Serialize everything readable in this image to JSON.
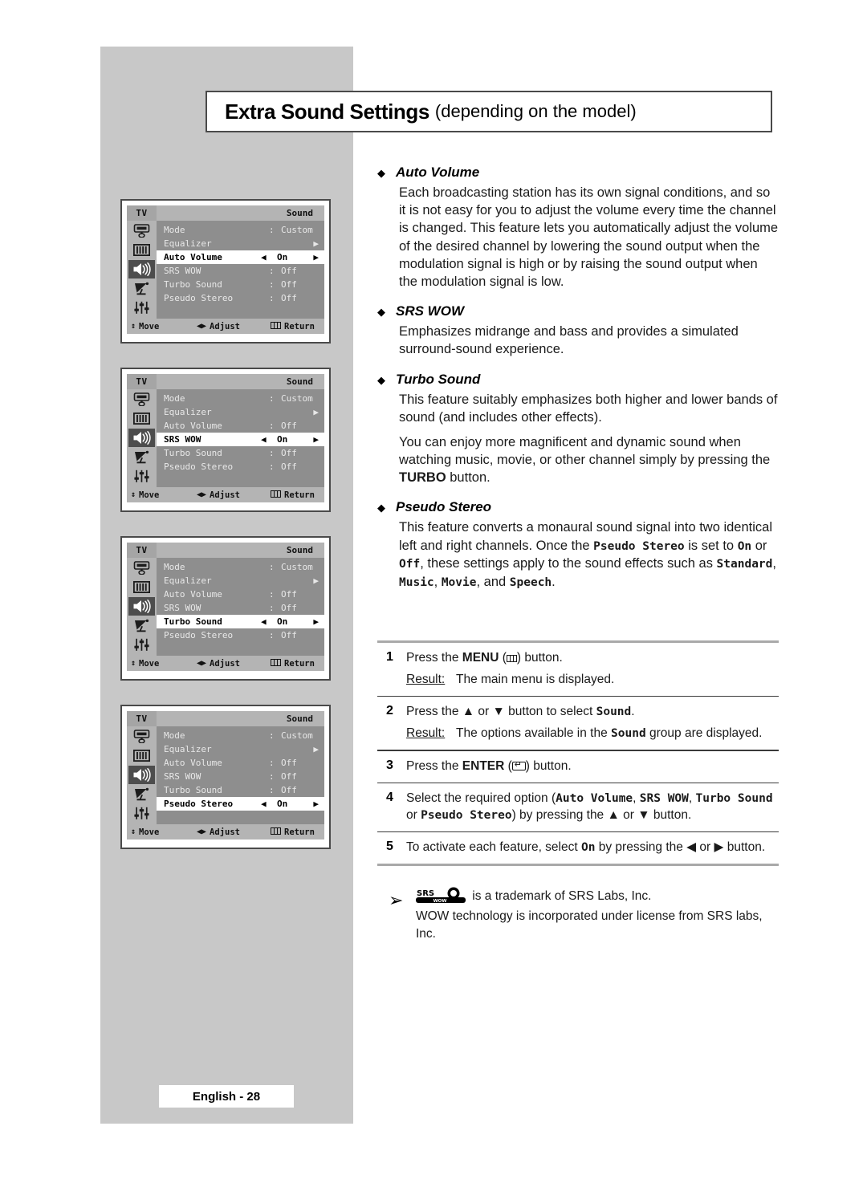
{
  "header": {
    "title_main": "Extra Sound Settings",
    "title_sub": "(depending on the model)"
  },
  "osd_common": {
    "tv_tag": "TV",
    "group_title": "Sound",
    "bottom_bar": {
      "move_label": "Move",
      "adjust_label": "Adjust",
      "return_label": "Return",
      "move_glyph": "↕",
      "adjust_glyph": "◀▶"
    },
    "icons": [
      "picture-icon",
      "equalizer-icon",
      "speaker-icon",
      "satellite-dish-icon",
      "sliders-icon"
    ],
    "rows": {
      "mode": "Mode",
      "equalizer": "Equalizer",
      "auto_volume": "Auto Volume",
      "srs_wow": "SRS WOW",
      "turbo_sound": "Turbo Sound",
      "pseudo_stereo": "Pseudo Stereo"
    },
    "values": {
      "custom": "Custom",
      "on": "On",
      "off": "Off",
      "colon": ":",
      "left_arrow": "◀",
      "right_arrow": "▶",
      "submenu_arrow": "▶"
    }
  },
  "osd_panels": [
    {
      "name": "panel-auto-volume",
      "selected": "auto_volume",
      "values": {
        "auto_volume": "On",
        "srs_wow": "Off",
        "turbo_sound": "Off",
        "pseudo_stereo": "Off"
      }
    },
    {
      "name": "panel-srs-wow",
      "selected": "srs_wow",
      "values": {
        "auto_volume": "Off",
        "srs_wow": "On",
        "turbo_sound": "Off",
        "pseudo_stereo": "Off"
      }
    },
    {
      "name": "panel-turbo-sound",
      "selected": "turbo_sound",
      "values": {
        "auto_volume": "Off",
        "srs_wow": "Off",
        "turbo_sound": "On",
        "pseudo_stereo": "Off"
      }
    },
    {
      "name": "panel-pseudo-stereo",
      "selected": "pseudo_stereo",
      "values": {
        "auto_volume": "Off",
        "srs_wow": "Off",
        "turbo_sound": "Off",
        "pseudo_stereo": "On"
      }
    }
  ],
  "features": [
    {
      "bullet": "◆",
      "title": "Auto Volume",
      "paragraphs": [
        "Each broadcasting station has its own signal conditions, and so it is not easy for you to adjust the volume every time the channel is changed. This feature lets you automatically adjust the volume of the desired channel by lowering the sound output when the modulation signal is high or by raising the sound output when the modulation signal is low."
      ]
    },
    {
      "bullet": "◆",
      "title": "SRS WOW",
      "paragraphs": [
        "Emphasizes midrange and bass and provides a simulated surround-sound experience."
      ]
    },
    {
      "bullet": "◆",
      "title": "Turbo Sound",
      "paragraphs": [
        "This feature suitably emphasizes both higher and lower bands of sound (and includes other effects)."
      ]
    },
    {
      "bullet": "◆",
      "title": "Pseudo Stereo",
      "paragraphs": []
    }
  ],
  "turbo_second_para": {
    "pre": "You can enjoy more magnificent and dynamic sound when watching music, movie, or other channel simply by pressing the ",
    "bold": "TURBO",
    "post": " button."
  },
  "pseudo_para": {
    "p1": "This feature converts a monaural sound signal into two identical left and right channels. Once the ",
    "m1": "Pseudo Stereo",
    "p2": " is set to ",
    "m2": "On",
    "p3": " or ",
    "m3": "Off",
    "p4": ", these settings apply to the sound effects such as ",
    "m4": "Standard",
    "p5": ", ",
    "m5": "Music",
    "p6": ", ",
    "m6": "Movie",
    "p7": ", and ",
    "m7": "Speech",
    "p8": "."
  },
  "steps": {
    "step1": {
      "num": "1",
      "pre": "Press the ",
      "bold": "MENU",
      "mid": " (",
      "post": ") button.",
      "result_label": "Result:",
      "result_text": "The main menu is displayed."
    },
    "step2": {
      "num": "2",
      "pre": "Press the ▲ or ▼ button to select ",
      "mono": "Sound",
      "post": ".",
      "result_label": "Result:",
      "result_pre": "The options available in the ",
      "result_mono": "Sound",
      "result_post": " group are displayed."
    },
    "step3": {
      "num": "3",
      "pre": "Press the ",
      "bold": "ENTER",
      "mid": " (",
      "post": ") button."
    },
    "step4": {
      "num": "4",
      "pre": "Select the required option (",
      "m1": "Auto Volume",
      "s1": ", ",
      "m2": "SRS WOW",
      "s2": ", ",
      "m3": "Turbo Sound",
      "s3": " or ",
      "m4": "Pseudo Stereo",
      "post": ") by pressing the ▲ or ▼ button."
    },
    "step5": {
      "num": "5",
      "pre": "To activate each feature, select ",
      "mono": "On",
      "post": " by pressing the ◀ or ▶ button."
    }
  },
  "trademark": {
    "arrow": "➢",
    "logo_text": "SRS",
    "logo_sub": "WOW",
    "line1_post": " is a trademark of SRS Labs, Inc.",
    "line2": "WOW technology is incorporated under license from SRS labs, Inc."
  },
  "footer": {
    "page_label": "English - 28"
  },
  "colors": {
    "band_grey": "#c8c8c8",
    "osd_bar_grey": "#b4b4b4",
    "osd_body_grey": "#8e8e8e",
    "osd_icon_active": "#4d4d4d",
    "border_dark": "#4a4a4a",
    "separator": "#a9a9a9"
  }
}
